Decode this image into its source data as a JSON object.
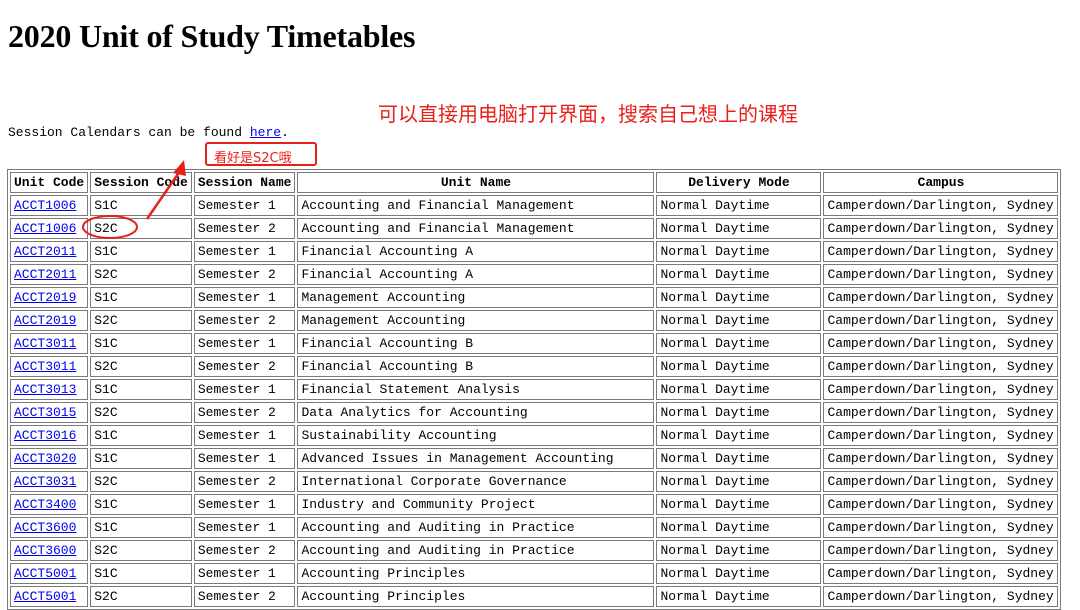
{
  "page": {
    "title": "2020 Unit of Study Timetables",
    "intro_prefix": "Session Calendars can be found ",
    "intro_link": "here",
    "intro_suffix": "."
  },
  "annotations": {
    "main_text": "可以直接用电脑打开界面，搜索自己想上的课程",
    "box_text": "看好是S2C哦",
    "color": "#e8201b"
  },
  "colors": {
    "link": "#0000ee",
    "border": "#7a7a7a"
  },
  "table": {
    "headers": [
      "Unit Code",
      "Session Code",
      "Session Name",
      "Unit Name",
      "Delivery Mode",
      "Campus"
    ],
    "rows": [
      [
        "ACCT1006",
        "S1C",
        "Semester 1",
        "Accounting and Financial Management",
        "Normal Daytime",
        "Camperdown/Darlington, Sydney"
      ],
      [
        "ACCT1006",
        "S2C",
        "Semester 2",
        "Accounting and Financial Management",
        "Normal Daytime",
        "Camperdown/Darlington, Sydney"
      ],
      [
        "ACCT2011",
        "S1C",
        "Semester 1",
        "Financial Accounting A",
        "Normal Daytime",
        "Camperdown/Darlington, Sydney"
      ],
      [
        "ACCT2011",
        "S2C",
        "Semester 2",
        "Financial Accounting A",
        "Normal Daytime",
        "Camperdown/Darlington, Sydney"
      ],
      [
        "ACCT2019",
        "S1C",
        "Semester 1",
        "Management Accounting",
        "Normal Daytime",
        "Camperdown/Darlington, Sydney"
      ],
      [
        "ACCT2019",
        "S2C",
        "Semester 2",
        "Management Accounting",
        "Normal Daytime",
        "Camperdown/Darlington, Sydney"
      ],
      [
        "ACCT3011",
        "S1C",
        "Semester 1",
        "Financial Accounting B",
        "Normal Daytime",
        "Camperdown/Darlington, Sydney"
      ],
      [
        "ACCT3011",
        "S2C",
        "Semester 2",
        "Financial Accounting B",
        "Normal Daytime",
        "Camperdown/Darlington, Sydney"
      ],
      [
        "ACCT3013",
        "S1C",
        "Semester 1",
        "Financial Statement Analysis",
        "Normal Daytime",
        "Camperdown/Darlington, Sydney"
      ],
      [
        "ACCT3015",
        "S2C",
        "Semester 2",
        "Data Analytics for Accounting",
        "Normal Daytime",
        "Camperdown/Darlington, Sydney"
      ],
      [
        "ACCT3016",
        "S1C",
        "Semester 1",
        "Sustainability Accounting",
        "Normal Daytime",
        "Camperdown/Darlington, Sydney"
      ],
      [
        "ACCT3020",
        "S1C",
        "Semester 1",
        "Advanced Issues in Management Accounting",
        "Normal Daytime",
        "Camperdown/Darlington, Sydney"
      ],
      [
        "ACCT3031",
        "S2C",
        "Semester 2",
        "International Corporate Governance",
        "Normal Daytime",
        "Camperdown/Darlington, Sydney"
      ],
      [
        "ACCT3400",
        "S1C",
        "Semester 1",
        "Industry and Community Project",
        "Normal Daytime",
        "Camperdown/Darlington, Sydney"
      ],
      [
        "ACCT3600",
        "S1C",
        "Semester 1",
        "Accounting and Auditing in Practice",
        "Normal Daytime",
        "Camperdown/Darlington, Sydney"
      ],
      [
        "ACCT3600",
        "S2C",
        "Semester 2",
        "Accounting and Auditing in Practice",
        "Normal Daytime",
        "Camperdown/Darlington, Sydney"
      ],
      [
        "ACCT5001",
        "S1C",
        "Semester 1",
        "Accounting Principles",
        "Normal Daytime",
        "Camperdown/Darlington, Sydney"
      ],
      [
        "ACCT5001",
        "S2C",
        "Semester 2",
        "Accounting Principles",
        "Normal Daytime",
        "Camperdown/Darlington, Sydney"
      ]
    ]
  }
}
